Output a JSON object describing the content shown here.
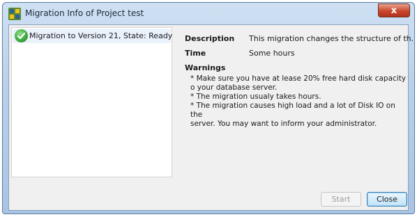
{
  "window": {
    "title": "Migration Info of Project test",
    "close_glyph": "x"
  },
  "list": {
    "items": [
      {
        "label": "Migration to Version 21, State: Ready",
        "icon": "check-icon"
      }
    ]
  },
  "details": {
    "description_label": "Description",
    "description_value": "This migration changes the structure of th...",
    "time_label": "Time",
    "time_value": "Some hours",
    "warnings_label": "Warnings",
    "warnings": [
      "* Make sure you have at lease 20% free hard disk capacity",
      "o your database server.",
      "* The migration usualy takes hours.",
      "* The migration causes high load and a lot of Disk IO on the",
      "server. You may want to inform your administrator."
    ]
  },
  "buttons": {
    "start_label": "Start",
    "close_label": "Close"
  }
}
